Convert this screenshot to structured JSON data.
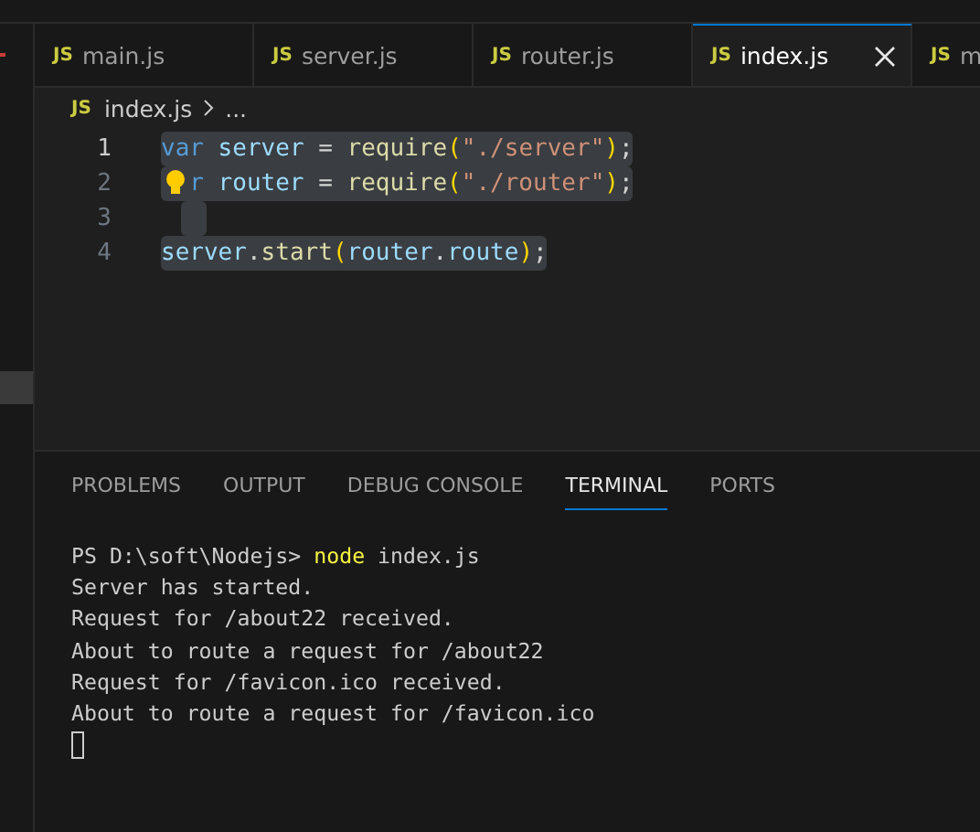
{
  "tabs": [
    {
      "icon": "JS",
      "label": "main.js",
      "selected": false
    },
    {
      "icon": "JS",
      "label": "server.js",
      "selected": false
    },
    {
      "icon": "JS",
      "label": "router.js",
      "selected": false
    },
    {
      "icon": "JS",
      "label": "index.js",
      "selected": true
    },
    {
      "icon": "JS",
      "label": "m",
      "selected": false
    }
  ],
  "breadcrumb": {
    "icon": "JS",
    "file": "index.js",
    "rest": "..."
  },
  "code_lines": [
    {
      "number": "1",
      "current": true,
      "tokens": [
        {
          "text": "var",
          "kind": "keyword"
        },
        {
          "text": " server",
          "kind": "variable"
        },
        {
          "text": " = ",
          "kind": "operator"
        },
        {
          "text": "require",
          "kind": "function"
        },
        {
          "text": "(",
          "kind": "bracket"
        },
        {
          "text": "\"./server\"",
          "kind": "string"
        },
        {
          "text": ")",
          "kind": "bracket"
        },
        {
          "text": ";",
          "kind": "punct"
        }
      ]
    },
    {
      "number": "2",
      "current": false,
      "lightbulb": true,
      "tokens": [
        {
          "text": "r",
          "kind": "keyword"
        },
        {
          "text": " router",
          "kind": "variable"
        },
        {
          "text": " = ",
          "kind": "operator"
        },
        {
          "text": "require",
          "kind": "function"
        },
        {
          "text": "(",
          "kind": "bracket"
        },
        {
          "text": "\"./router\"",
          "kind": "string"
        },
        {
          "text": ")",
          "kind": "bracket"
        },
        {
          "text": ";",
          "kind": "punct"
        }
      ]
    },
    {
      "number": "3",
      "current": false
    },
    {
      "number": "4",
      "current": false,
      "tokens": [
        {
          "text": "server",
          "kind": "variable"
        },
        {
          "text": ".",
          "kind": "punct"
        },
        {
          "text": "start",
          "kind": "function"
        },
        {
          "text": "(",
          "kind": "bracket"
        },
        {
          "text": "router",
          "kind": "variable"
        },
        {
          "text": ".",
          "kind": "punct"
        },
        {
          "text": "route",
          "kind": "variable"
        },
        {
          "text": ")",
          "kind": "bracket"
        },
        {
          "text": ";",
          "kind": "punct"
        }
      ]
    }
  ],
  "panel_tabs": [
    {
      "label": "PROBLEMS",
      "selected": false
    },
    {
      "label": "OUTPUT",
      "selected": false
    },
    {
      "label": "DEBUG CONSOLE",
      "selected": false
    },
    {
      "label": "TERMINAL",
      "selected": true
    },
    {
      "label": "PORTS",
      "selected": false
    }
  ],
  "terminal_lines": [
    {
      "kind": "command",
      "prompt": "PS D:\\soft\\Nodejs> ",
      "command": "node",
      "args": " index.js"
    },
    {
      "kind": "output",
      "text": "Server has started."
    },
    {
      "kind": "output",
      "text": "Request for /about22 received."
    },
    {
      "kind": "output",
      "text": "About to route a request for /about22"
    },
    {
      "kind": "output",
      "text": "Request for /favicon.ico received."
    },
    {
      "kind": "output",
      "text": "About to route a request for /favicon.ico"
    },
    {
      "kind": "cursor"
    }
  ]
}
